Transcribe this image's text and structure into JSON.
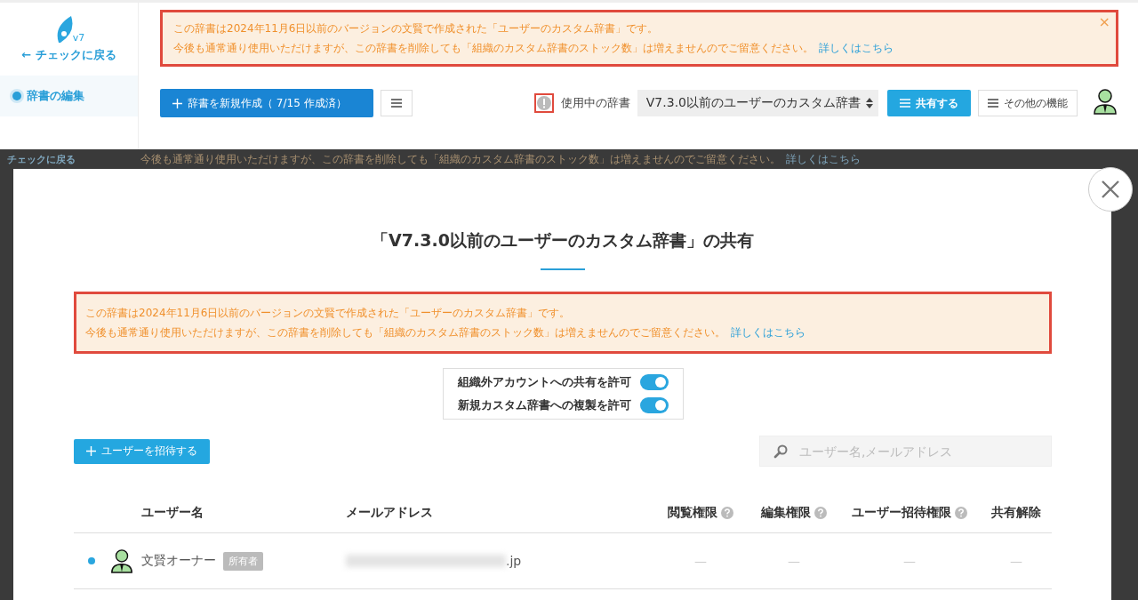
{
  "sidebar": {
    "logo_version": "v7",
    "back_link": "← チェックに戻る",
    "items": [
      {
        "label": "辞書の編集",
        "selected": true
      }
    ]
  },
  "notice": {
    "lines": [
      "この辞書は2024年11月6日以前のバージョンの文賢で作成された「ユーザーのカスタム辞書」です。",
      "今後も通常通り使用いただけますが、この辞書を削除しても「組織のカスタム辞書のストック数」は増えませんのでご留意ください。"
    ],
    "link": "詳しくはこちら",
    "close": "×"
  },
  "toolbar": {
    "new_button": "辞書を新規作成（ 7/15 作成済）",
    "dictionary_label": "使用中の辞書",
    "dictionary_value": "V7.3.0以前のユーザーのカスタム辞書",
    "share_button": "共有する",
    "more_button": "その他の機能"
  },
  "dimmed_page": {
    "back_link": "チェックに戻る",
    "notice_line": "今後も通常通り使用いただけますが、この辞書を削除しても「組織のカスタム辞書のストック数」は増えませんのでご留意ください。",
    "notice_link": "詳しくはこちら"
  },
  "modal": {
    "title": "「V7.3.0以前のユーザーのカスタム辞書」の共有",
    "notice": {
      "lines": [
        "この辞書は2024年11月6日以前のバージョンの文賢で作成された「ユーザーのカスタム辞書」です。",
        "今後も通常通り使用いただけますが、この辞書を削除しても「組織のカスタム辞書のストック数」は増えませんのでご留意ください。"
      ],
      "link": "詳しくはこちら"
    },
    "settings": [
      {
        "label": "組織外アカウントへの共有を許可",
        "on": true
      },
      {
        "label": "新規カスタム辞書への複製を許可",
        "on": true
      }
    ],
    "invite_button": "ユーザーを招待する",
    "search": {
      "placeholder": "ユーザー名,メールアドレス"
    },
    "table": {
      "columns": [
        {
          "label": "ユーザー名",
          "help": false
        },
        {
          "label": "メールアドレス",
          "help": false
        },
        {
          "label": "閲覧権限",
          "help": true
        },
        {
          "label": "編集権限",
          "help": true
        },
        {
          "label": "ユーザー招待権限",
          "help": true
        },
        {
          "label": "共有解除",
          "help": false
        }
      ],
      "rows": [
        {
          "current": true,
          "cells": [
            {
              "text": "文賢オーナー",
              "badge": "所有者"
            },
            {
              "text": ".jp",
              "blurred": true
            },
            {
              "text": "—"
            },
            {
              "text": "—"
            },
            {
              "text": "—"
            },
            {
              "text": "—"
            }
          ]
        }
      ]
    }
  }
}
